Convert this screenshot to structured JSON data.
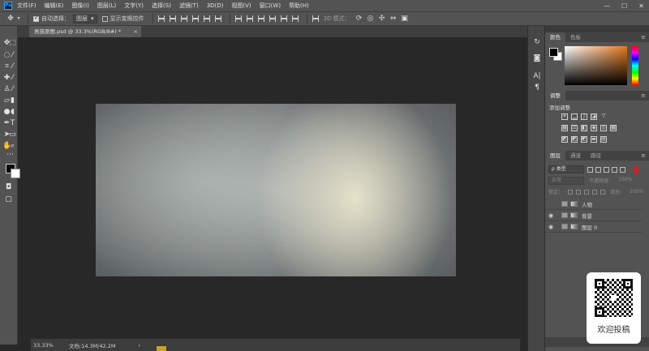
{
  "app": {
    "logo": "Ps"
  },
  "menu": [
    "文件(F)",
    "编辑(E)",
    "图像(I)",
    "图层(L)",
    "文字(Y)",
    "选择(S)",
    "滤镜(T)",
    "3D(D)",
    "视图(V)",
    "窗口(W)",
    "帮助(H)"
  ],
  "window_controls": {
    "minimize": "—",
    "maximize": "☐",
    "close": "✕"
  },
  "options": {
    "auto_select_label": "自动选择：",
    "auto_select_value": "图层",
    "show_transform_label": "显示变换控件",
    "mode_3d_label": "3D 模式："
  },
  "document": {
    "tab_title": "男孩原图.psd @ 33.3%(RGB/8#) *",
    "close": "×"
  },
  "status": {
    "zoom": "33.33%",
    "doc_size": "文档:14.3M/42.2M",
    "arrow": "›"
  },
  "panels": {
    "color_tabs": [
      "颜色",
      "色板"
    ],
    "adjust_tab": "调整",
    "adjust_title": "添加调整",
    "layer_tabs": [
      "图层",
      "通道",
      "路径"
    ],
    "filter_select": "ρ 类型",
    "blend_mode": "正常",
    "opacity_label": "不透明度：",
    "opacity_value": "100%",
    "lock_label": "锁定：",
    "fill_label": "填充：",
    "fill_value": "100%",
    "menu_icon": "≡"
  },
  "layers": [
    {
      "name": "人物",
      "visible": false
    },
    {
      "name": "背景",
      "visible": true
    },
    {
      "name": "图层 0",
      "visible": true
    }
  ],
  "overlay": {
    "text": "欢迎投稿"
  }
}
